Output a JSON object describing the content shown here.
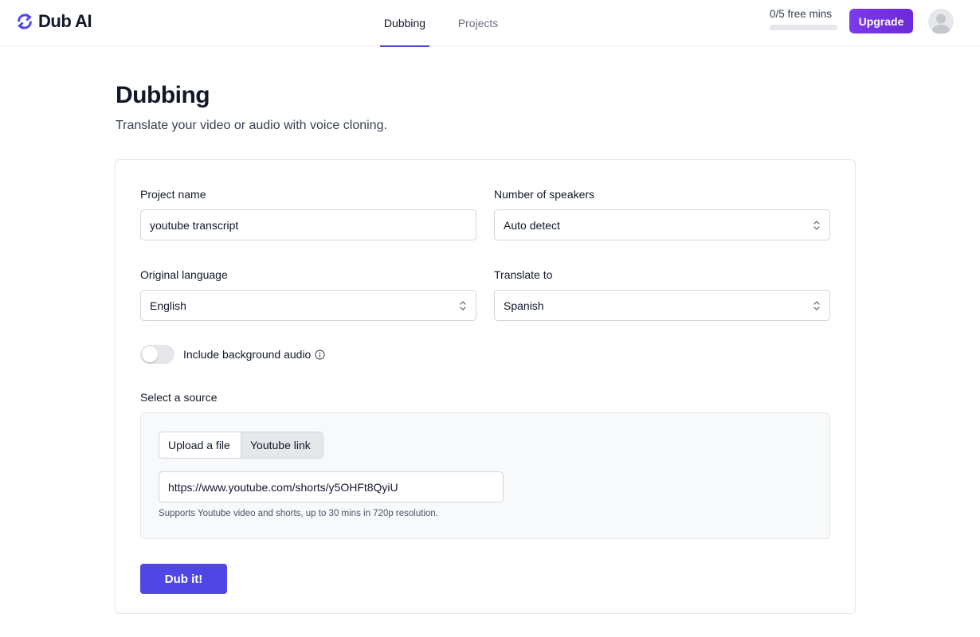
{
  "app": {
    "name": "Dub AI"
  },
  "nav": {
    "tabs": [
      {
        "label": "Dubbing",
        "active": true
      },
      {
        "label": "Projects",
        "active": false
      }
    ]
  },
  "usage": {
    "text": "0/5 free mins",
    "used_fraction": 0
  },
  "header": {
    "upgrade_label": "Upgrade",
    "avatar_icon": "user-avatar-icon"
  },
  "page": {
    "title": "Dubbing",
    "subtitle": "Translate your video or audio with voice cloning."
  },
  "form": {
    "project_name": {
      "label": "Project name",
      "value": "youtube transcript"
    },
    "speakers": {
      "label": "Number of speakers",
      "value": "Auto detect"
    },
    "original_language": {
      "label": "Original language",
      "value": "English"
    },
    "translate_to": {
      "label": "Translate to",
      "value": "Spanish"
    },
    "background_audio": {
      "label": "Include background audio",
      "enabled": false
    },
    "source": {
      "label": "Select a source",
      "tabs": [
        {
          "label": "Upload a file",
          "selected": false
        },
        {
          "label": "Youtube link",
          "selected": true
        }
      ],
      "url_value": "https://www.youtube.com/shorts/y5OHFt8QyiU",
      "hint": "Supports Youtube video and shorts, up to 30 mins in 720p resolution."
    },
    "submit_label": "Dub it!"
  },
  "colors": {
    "accent": "#4f46e5",
    "upgrade": "#7c3aed",
    "border": "#d1d5db"
  }
}
